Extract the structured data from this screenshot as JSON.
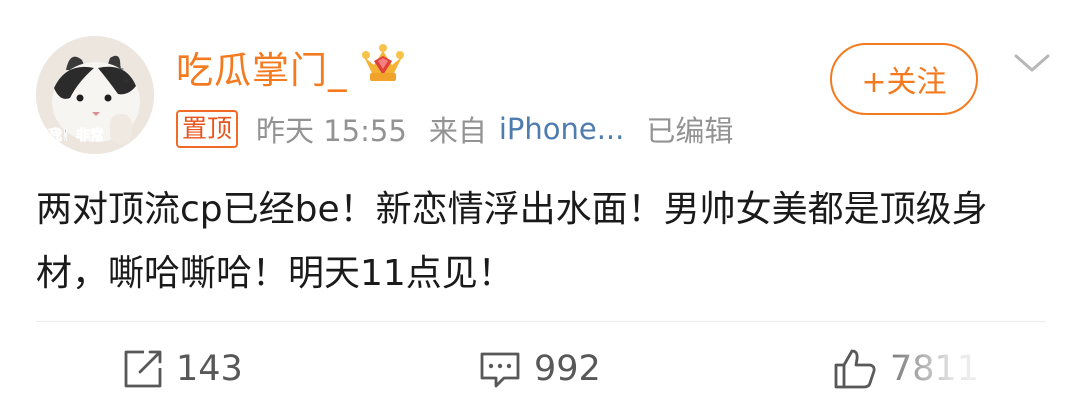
{
  "post": {
    "author": {
      "name": "吃瓜掌门_",
      "avatar_caption": "我！非常",
      "badge_icon": "crown-icon"
    },
    "follow_label": "+关注",
    "pinned_label": "置顶",
    "time": "昨天 15:55",
    "source_prefix": "来自",
    "source": "iPhone...",
    "edited": "已编辑",
    "text": "两对顶流cp已经be！新恋情浮出水面！男帅女美都是顶级身材，嘶哈嘶哈！明天11点见！"
  },
  "actions": {
    "repost_count": "143",
    "comment_count": "992",
    "like_count": "7811"
  },
  "colors": {
    "accent": "#f47a20",
    "link": "#4f7cae",
    "meta": "#939393",
    "text": "#1a1a1a"
  }
}
